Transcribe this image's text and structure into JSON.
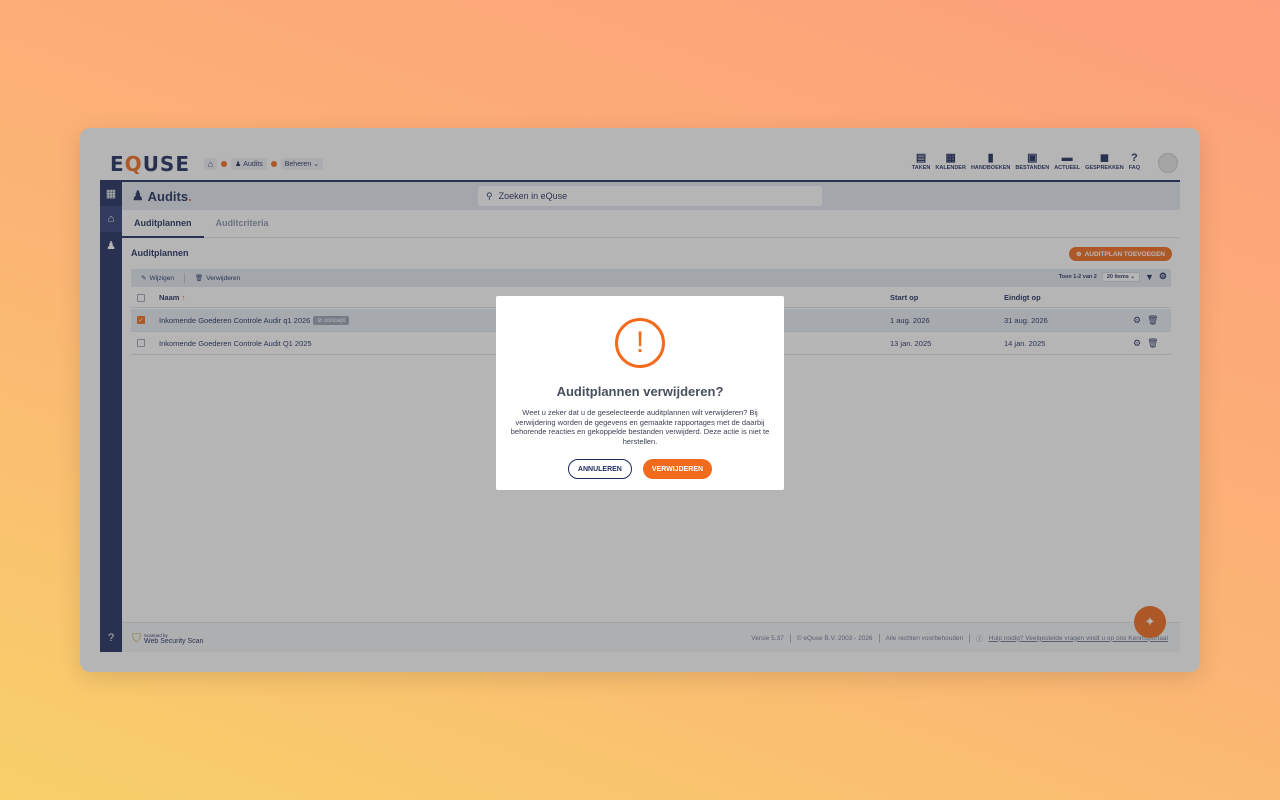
{
  "topbar": {
    "logo_pre": "E",
    "logo_q": "Q",
    "logo_post": "USE",
    "breadcrumb": {
      "audits": "Audits",
      "beheren": "Beheren"
    },
    "nav": [
      "TAKEN",
      "KALENDER",
      "HANDBOEKEN",
      "BESTANDEN",
      "ACTUEEL",
      "GESPREKKEN",
      "FAQ"
    ]
  },
  "header": {
    "title": "Audits",
    "title_dot": ".",
    "search_placeholder": "Zoeken in eQuse"
  },
  "tabs": [
    "Auditplannen",
    "Auditcriteria"
  ],
  "section": {
    "title": "Auditplannen",
    "add_button": "AUDITPLAN TOEVOEGEN"
  },
  "toolbar": {
    "edit": "Wijzigen",
    "delete": "Verwijderen",
    "pager_text": "Toon 1-2 van 2",
    "page_size": "20 items"
  },
  "table": {
    "columns": {
      "name": "Naam",
      "start": "Start op",
      "end": "Eindigt op"
    },
    "rows": [
      {
        "name": "Inkomende Goederen Controle Audir q1 2026",
        "badge": "concept",
        "start": "1 aug. 2026",
        "end": "31 aug. 2026",
        "checked": true
      },
      {
        "name": "Inkomende Goederen Controle Audit Q1 2025",
        "badge": "",
        "start": "13 jan. 2025",
        "end": "14 jan. 2025",
        "checked": false
      }
    ]
  },
  "footer": {
    "scan_small": "Scanned by",
    "scan_big": "Web Security Scan",
    "version": "Versie 5.37",
    "copyright": "© eQuse B.V. 2003 - 2026",
    "rights": "Alle rechten voorbehouden",
    "help": "Hulp nodig? Veelgestelde vragen vindt u op ons Kennisportaal"
  },
  "modal": {
    "icon": "!",
    "title": "Auditplannen verwijderen?",
    "text": "Weet u zeker dat u de geselecteerde auditplannen wilt verwijderen? Bij verwijdering worden de gegevens en gemaakte rapportages met de daarbij behorende reacties en gekoppelde bestanden verwijderd. Deze actie is niet te herstellen.",
    "cancel": "ANNULEREN",
    "confirm": "VERWIJDEREN"
  },
  "colors": {
    "brand_navy": "#1d2b5c",
    "accent_orange": "#f26a1b"
  }
}
